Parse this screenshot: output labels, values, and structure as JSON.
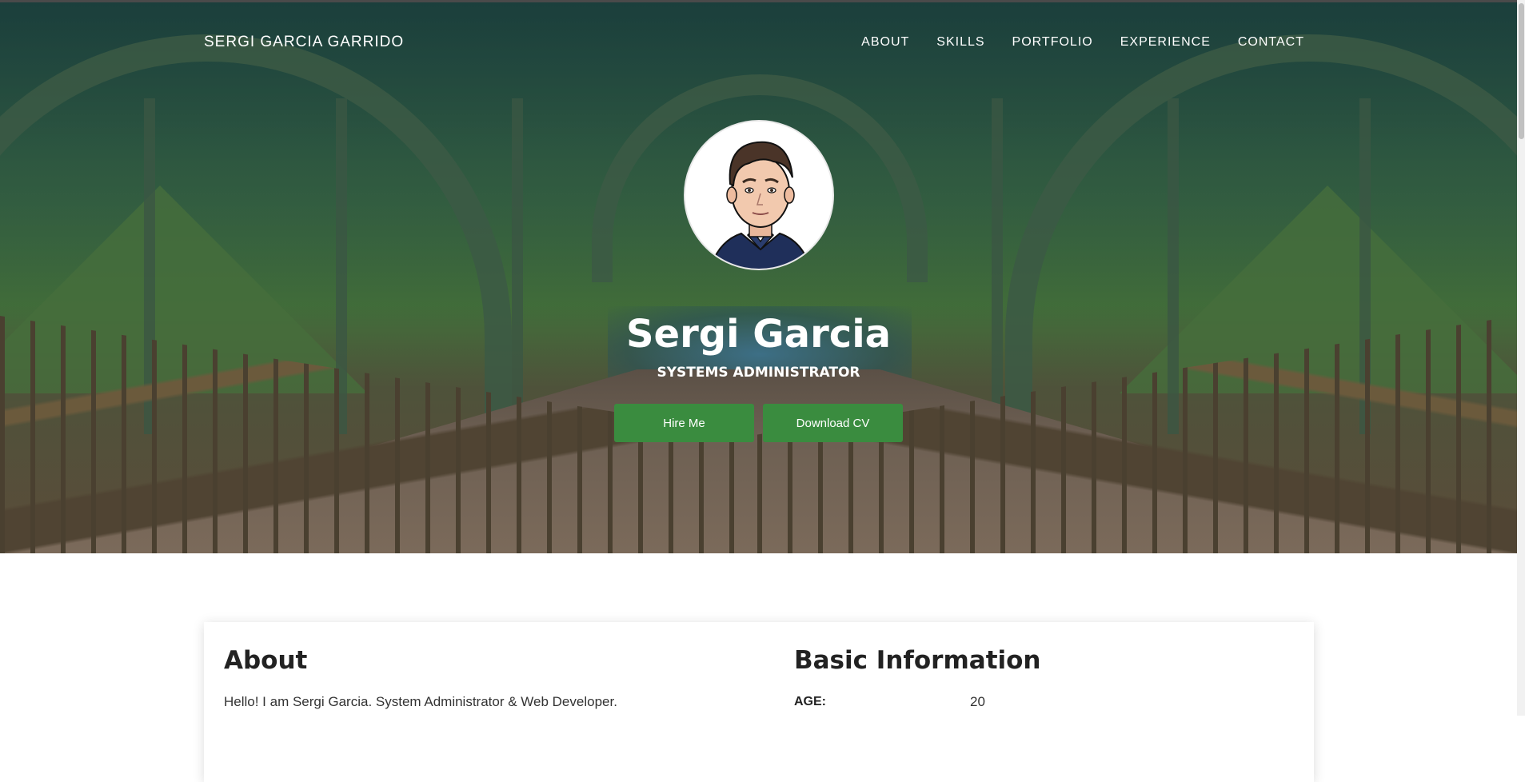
{
  "header": {
    "brand": "SERGI GARCIA GARRIDO",
    "nav": [
      {
        "label": "ABOUT"
      },
      {
        "label": "SKILLS"
      },
      {
        "label": "PORTFOLIO"
      },
      {
        "label": "EXPERIENCE"
      },
      {
        "label": "CONTACT"
      }
    ]
  },
  "hero": {
    "name": "Sergi Garcia",
    "role": "SYSTEMS ADMINISTRATOR",
    "hire_label": "Hire Me",
    "cv_label": "Download CV",
    "button_color": "#3a8c3f"
  },
  "about": {
    "title": "About",
    "text": "Hello! I am Sergi Garcia. System Administrator & Web Developer."
  },
  "basic_info": {
    "title": "Basic Information",
    "rows": [
      {
        "label": "AGE:",
        "value": "20"
      }
    ]
  }
}
